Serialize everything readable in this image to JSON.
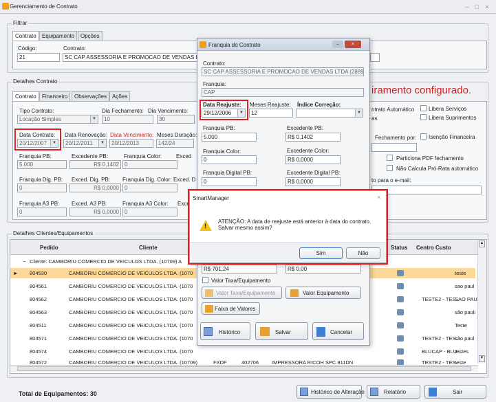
{
  "window": {
    "title": "Gerenciamento de Contrato"
  },
  "filter": {
    "legend": "Filtrar",
    "tabs": [
      "Contrato",
      "Equipamento",
      "Opções"
    ],
    "codigo_label": "Código:",
    "contrato_label": "Contrato:",
    "codigo_value": "21",
    "contrato_value": "SC CAP ASSESSORIA E PROMOCAO DE VENDAS LTD"
  },
  "details": {
    "legend": "Detalhes Contrato",
    "tabs": [
      "Contrato",
      "Financeiro",
      "Observações",
      "Ações"
    ],
    "tipo_label": "Tipo Contrato:",
    "tipo_value": "Locação Simples",
    "dia_fech_label": "Dia Fechamento:",
    "dia_fech_value": "10",
    "dia_venc_label": "Dia Vencimento:",
    "dia_venc_value": "30",
    "data_contrato_label": "Data Contrato:",
    "data_contrato_value": "20/12/2007",
    "data_renov_label": "Data Renovação:",
    "data_renov_value": "20/12/2011",
    "data_venc_label": "Data Vencimento:",
    "data_venc_value": "20/12/2013",
    "meses_dur_label": "Meses Duração:",
    "meses_dur_value": "142/24",
    "fpb_label": "Franquia PB:",
    "fpb_value": "5.000",
    "epb_label": "Excedente PB:",
    "epb_value": "R$ 0,1402",
    "fcolor_label": "Franquia Color:",
    "fcolor_value": "0",
    "ecolor_label": "Exced",
    "fdpb_label": "Franquia Dig. PB:",
    "fdpb_value": "0",
    "edpb_label": "Exced. Dig. PB:",
    "edpb_value": "R$ 0,0000",
    "fdcolor_label": "Franquia Dig. Color:",
    "fdcolor_value": "0",
    "edcolor_label": "Exced. D",
    "fa3_label": "Franquia A3 PB:",
    "fa3_value": "0",
    "ea3_label": "Exced. A3 PB:",
    "ea3_value": "R$ 0,0000",
    "fa3c_label": "Franquia A3 Color:",
    "fa3c_value": "0",
    "ea3c_label": "Exce"
  },
  "right": {
    "banner": "iramento configurado.",
    "contrato_auto": "ntrato Automático",
    "libera_servicos": "Libera Serviços",
    "as": "as",
    "libera_suprimentos": "Libera Suprimentos",
    "fechamento_por": "Fechamento por:",
    "isencao": "Isenção Financeira",
    "particiona": "Particiona PDF fechamento",
    "nao_calcula": "Não Calcula Pró-Rata automático",
    "email": "to para o e-mail:"
  },
  "grid": {
    "legend": "Detalhes Clientes/Equipamentos",
    "col_pedido": "Pedido",
    "col_cliente": "Cliente",
    "col_status": "Status",
    "col_centro": "Centro Custo",
    "group": "Cliente: CAMBORIU COMERCIO DE VEICULOS LTDA. (10709) A",
    "rows": [
      {
        "pedido": "804530",
        "cliente": "CAMBORIU COMERCIO DE VEICULOS LTDA. (1070",
        "centro": "",
        "extra": "teste"
      },
      {
        "pedido": "804561",
        "cliente": "CAMBORIU COMERCIO DE VEICULOS LTDA. (1070",
        "centro": "",
        "extra": "sao paul"
      },
      {
        "pedido": "804562",
        "cliente": "CAMBORIU COMERCIO DE VEICULOS LTDA. (1070",
        "centro": "TESTE2 - TES..",
        "extra": "SAO PAU"
      },
      {
        "pedido": "804563",
        "cliente": "CAMBORIU COMERCIO DE VEICULOS LTDA. (1070",
        "centro": "",
        "extra": "são pauli"
      },
      {
        "pedido": "804511",
        "cliente": "CAMBORIU COMERCIO DE VEICULOS LTDA. (1070",
        "centro": "",
        "extra": "Teste"
      },
      {
        "pedido": "804571",
        "cliente": "CAMBORIU COMERCIO DE VEICULOS LTDA. (1070",
        "centro": "TESTE2 - TES..",
        "extra": "são paul"
      },
      {
        "pedido": "804574",
        "cliente": "CAMBORIU COMERCIO DE VEICULOS LTDA. (1070",
        "centro": "BLUCAP - BLU..",
        "extra": "testes"
      },
      {
        "pedido": "804572",
        "cliente": "CAMBORIU COMERCIO DE VEICULOS LTDA. (10709)",
        "centro": "TESTE2 - TES..",
        "extra": "teste",
        "c3": "FXDF",
        "c4": "402706",
        "c5": "IMPRESSORA RICOH SPC 811DN"
      }
    ]
  },
  "footer": {
    "total": "Total de Equipamentos: 30",
    "historico": "Histórico de Alteração",
    "relatorio": "Relatório",
    "sair": "Sair"
  },
  "franquia": {
    "title": "Franquia do Contrato",
    "contrato_label": "Contrato:",
    "contrato_value": "SC CAP ASSESSORIA E PROMOCAO DE VENDAS LTDA (28893)",
    "franquia_label": "Franquia:",
    "franquia_value": "CAP",
    "data_reajuste_label": "Data Reajuste:",
    "data_reajuste_value": "29/12/2006",
    "meses_reajuste_label": "Meses Reajuste:",
    "meses_reajuste_value": "12",
    "indice_label": "Índice Correção:",
    "fpb_label": "Franquia PB:",
    "fpb_value": "5.000",
    "epb_label": "Excedente PB:",
    "epb_value": "R$ 0,1402",
    "fcolor_label": "Franquia Color:",
    "fcolor_value": "0",
    "ecolor_label": "Excedente Color:",
    "ecolor_value": "R$ 0,0000",
    "fdpb_label": "Franquia Digital PB:",
    "fdpb_value": "0",
    "edpb_label": "Excedente Digital PB:",
    "edpb_value": "R$ 0,0000",
    "valor1": "R$ 701,24",
    "valor2": "R$ 0,00",
    "valor_taxa_chk": "Valor Taxa/Equipamento",
    "valor_taxa_btn": "Valor Taxa/Equipamento",
    "valor_equip_btn": "Valor Equipamento",
    "faixa_btn": "Faixa de Valores",
    "historico_btn": "Histórico",
    "salvar_btn": "Salvar",
    "cancelar_btn": "Cancelar"
  },
  "msgbox": {
    "title": "SmartManager",
    "message_line1": "ATENÇÃO: A data de reajuste está anterior à data do contrato.",
    "message_line2": "Salvar mesmo assim?",
    "sim": "Sim",
    "nao": "Não"
  }
}
